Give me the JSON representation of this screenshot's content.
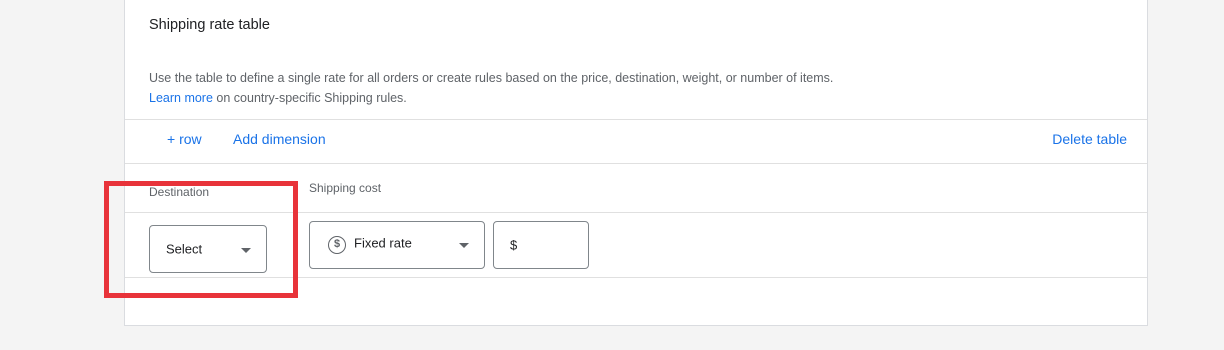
{
  "card": {
    "title": "Shipping rate table",
    "description": "Use the table to define a single rate for all orders or create rules based on the price, destination, weight, or number of items.",
    "learn_more_link": "Learn more",
    "learn_more_suffix": " on country-specific Shipping rules."
  },
  "toolbar": {
    "add_row": "+ row",
    "add_dimension": "Add dimension",
    "delete_table": "Delete table"
  },
  "columns": {
    "destination": "Destination",
    "shipping_cost": "Shipping cost"
  },
  "row": {
    "destination_select": "Select",
    "rate_type_select": "Fixed rate",
    "currency_symbol": "$",
    "amount_value": ""
  },
  "colors": {
    "accent": "#1a73e8",
    "highlight": "#e8333a"
  },
  "icons": {
    "rate_type": "dollar-coin-icon",
    "dropdown": "caret-down-icon"
  }
}
